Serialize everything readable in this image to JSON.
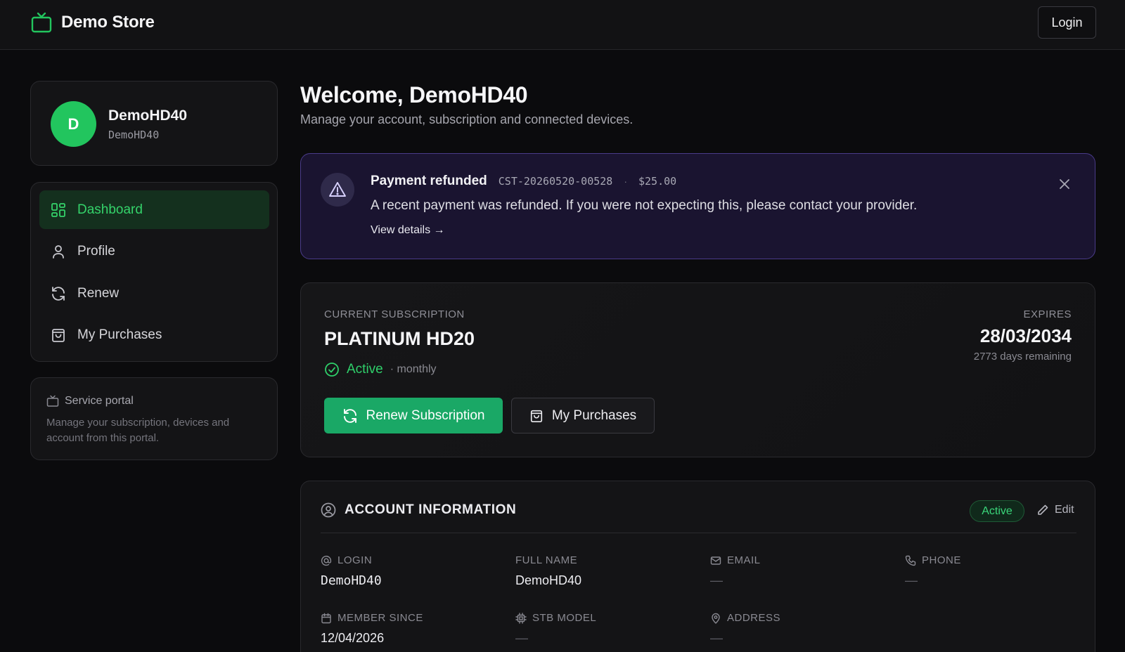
{
  "header": {
    "brand": "Demo Store",
    "login_label": "Login"
  },
  "profile": {
    "avatar_initial": "D",
    "name": "DemoHD40",
    "username": "DemoHD40"
  },
  "nav": {
    "items": [
      {
        "label": "Dashboard",
        "icon": "grid-icon",
        "active": true
      },
      {
        "label": "Profile",
        "icon": "user-icon",
        "active": false
      },
      {
        "label": "Renew",
        "icon": "refresh-icon",
        "active": false
      },
      {
        "label": "My Purchases",
        "icon": "shopping-bag-icon",
        "active": false
      }
    ]
  },
  "portal": {
    "title": "Service portal",
    "description": "Manage your subscription, devices and account from this portal."
  },
  "welcome": {
    "title": "Welcome, DemoHD40",
    "subtitle": "Manage your account, subscription and connected devices."
  },
  "alert": {
    "title": "Payment refunded",
    "code": "CST-20260520-00528",
    "separator": "·",
    "amount": "$25.00",
    "message": "A recent payment was refunded. If you were not expecting this, please contact your provider.",
    "link": "View details →"
  },
  "subscription": {
    "label": "CURRENT SUBSCRIPTION",
    "plan": "PLATINUM HD20",
    "status": "Active",
    "period": "· monthly",
    "expires_label": "EXPIRES",
    "expires_date": "28/03/2034",
    "remaining": "2773 days remaining",
    "renew_label": "Renew Subscription",
    "purchases_label": "My Purchases"
  },
  "account": {
    "title": "ACCOUNT INFORMATION",
    "badge": "Active",
    "edit_label": "Edit",
    "fields": [
      {
        "label": "LOGIN",
        "value": "DemoHD40",
        "icon": "at-icon"
      },
      {
        "label": "FULL NAME",
        "value": "DemoHD40",
        "icon": ""
      },
      {
        "label": "EMAIL",
        "value": "—",
        "icon": "mail-icon"
      },
      {
        "label": "PHONE",
        "value": "—",
        "icon": "phone-icon"
      },
      {
        "label": "MEMBER SINCE",
        "value": "12/04/2026",
        "icon": "calendar-icon"
      },
      {
        "label": "STB MODEL",
        "value": "—",
        "icon": "chip-icon"
      },
      {
        "label": "ADDRESS",
        "value": "—",
        "icon": "map-pin-icon"
      }
    ]
  },
  "colors": {
    "accent_green": "#22c55e",
    "button_green": "#1aa866",
    "alert_border": "#4a3b8a",
    "background": "#0b0b0d"
  }
}
